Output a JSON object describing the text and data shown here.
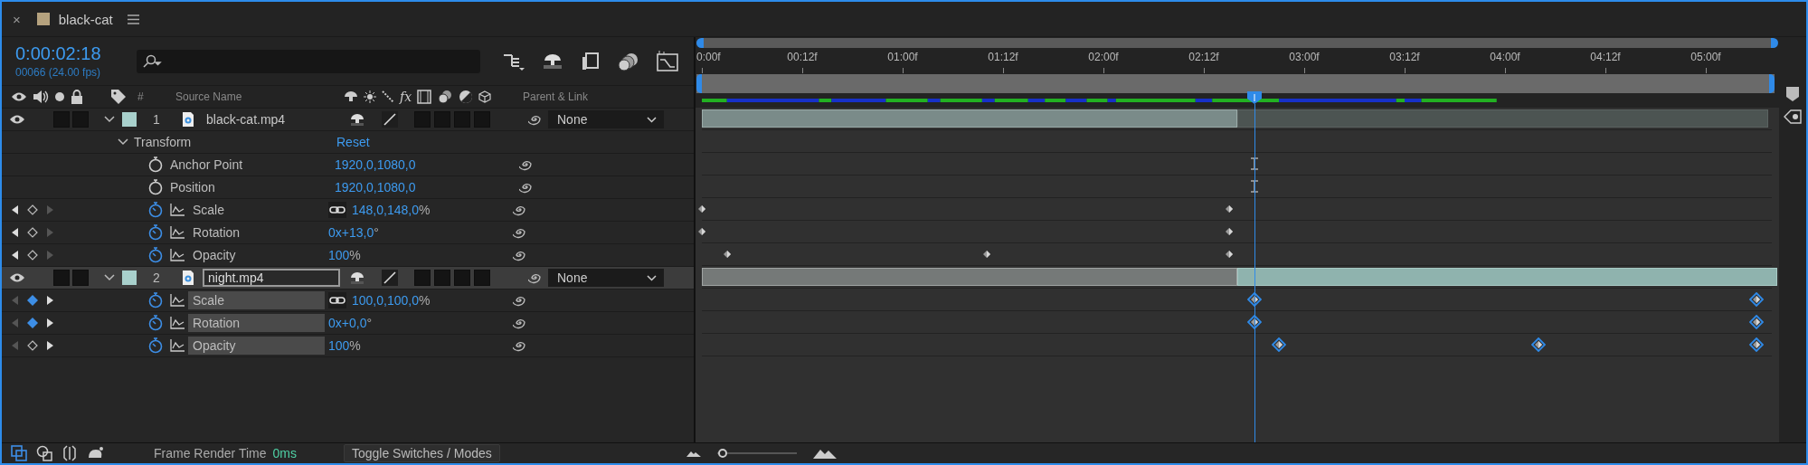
{
  "tab": {
    "close": "×",
    "title": "black-cat",
    "color": "#b5a27e"
  },
  "timecode": "0:00:02:18",
  "frame_info": "00066 (24.00 fps)",
  "columns": {
    "fx": "fx",
    "number": "#",
    "source_name": "Source Name",
    "parent": "Parent & Link"
  },
  "ruler": [
    "0:00f",
    "00:12f",
    "01:00f",
    "01:12f",
    "02:00f",
    "02:12f",
    "03:00f",
    "03:12f",
    "04:00f",
    "04:12f",
    "05:00f"
  ],
  "layers": [
    {
      "number": "1",
      "name": "black-cat.mp4",
      "visible": true,
      "color": "#a8d0cc",
      "selected": false,
      "renaming": false,
      "expanded": true,
      "parent": "None",
      "children": [
        {
          "kind": "group",
          "name": "Transform",
          "action": "Reset",
          "expanded": true,
          "children": [
            {
              "kind": "property",
              "name": "Anchor Point",
              "value": "1920,0,1080,0",
              "animated": false,
              "selected": false
            },
            {
              "kind": "property",
              "name": "Position",
              "value": "1920,0,1080,0",
              "animated": false,
              "selected": false
            },
            {
              "kind": "property",
              "name": "Scale",
              "value": "148,0,148,0",
              "unit": "%",
              "animated": true,
              "at_keyframe": false,
              "linked": true,
              "selected": false
            },
            {
              "kind": "property",
              "name": "Rotation",
              "value": "0x+13,0",
              "unit": "°",
              "animated": true,
              "at_keyframe": false,
              "selected": false
            },
            {
              "kind": "property",
              "name": "Opacity",
              "value": "100",
              "unit": "%",
              "animated": true,
              "at_keyframe": false,
              "selected": false
            }
          ]
        }
      ]
    },
    {
      "number": "2",
      "name": "night.mp4",
      "visible": true,
      "color": "#a8d0cc",
      "selected": true,
      "renaming": true,
      "expanded": true,
      "parent": "None",
      "children": [
        {
          "kind": "property",
          "name": "Scale",
          "value": "100,0,100,0",
          "unit": "%",
          "animated": true,
          "at_keyframe": true,
          "linked": true,
          "selected": true
        },
        {
          "kind": "property",
          "name": "Rotation",
          "value": "0x+0,0",
          "unit": "°",
          "animated": true,
          "at_keyframe": true,
          "selected": true
        },
        {
          "kind": "property",
          "name": "Opacity",
          "value": "100",
          "unit": "%",
          "animated": true,
          "at_keyframe": false,
          "selected": true
        }
      ]
    }
  ],
  "footer": {
    "render_label": "Frame Render Time",
    "render_value": "0ms",
    "toggle": "Toggle Switches / Modes",
    "zoom": {
      "level": 0.02
    }
  }
}
